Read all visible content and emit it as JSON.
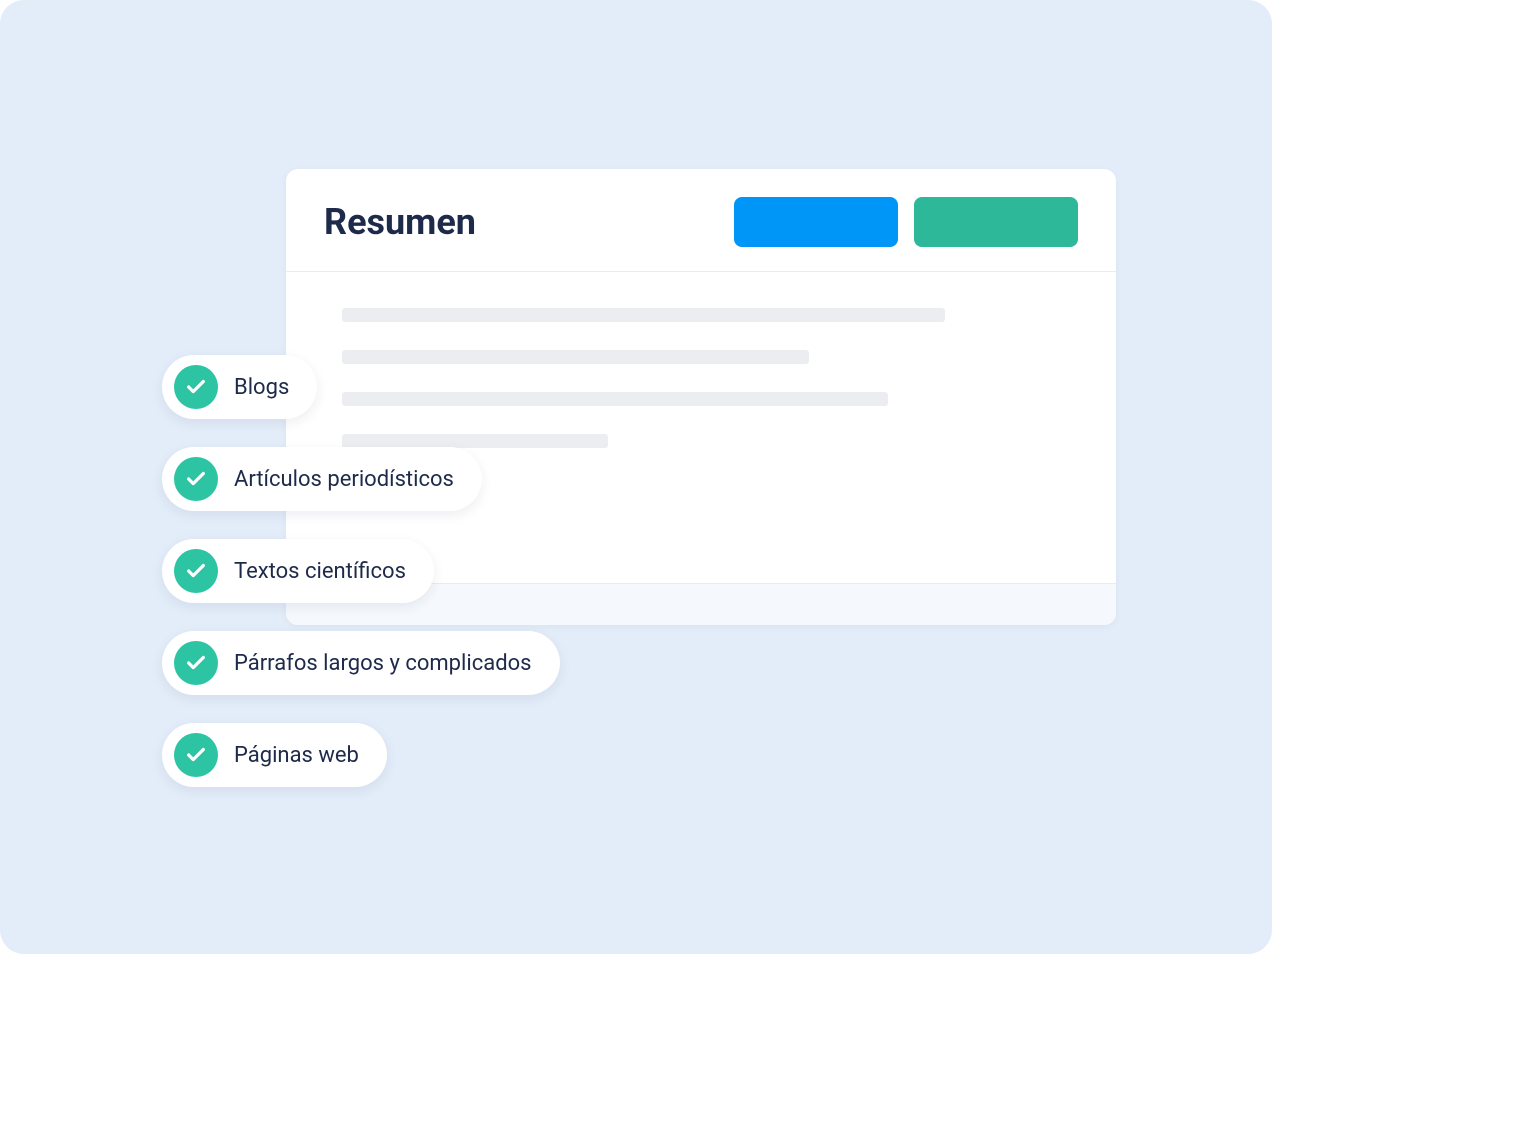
{
  "card": {
    "title": "Resumen",
    "placeholder_widths": [
      "84%",
      "65%",
      "76%",
      "37%"
    ]
  },
  "colors": {
    "button_primary": "#0096F7",
    "button_secondary": "#2DB89A",
    "check_bg": "#2DC4A4",
    "page_bg": "#E3EDF9",
    "text_dark": "#1E2A4A"
  },
  "pills": [
    {
      "label": "Blogs"
    },
    {
      "label": "Artículos periodísticos"
    },
    {
      "label": "Textos científicos"
    },
    {
      "label": "Párrafos largos y complicados"
    },
    {
      "label": "Páginas web"
    }
  ]
}
